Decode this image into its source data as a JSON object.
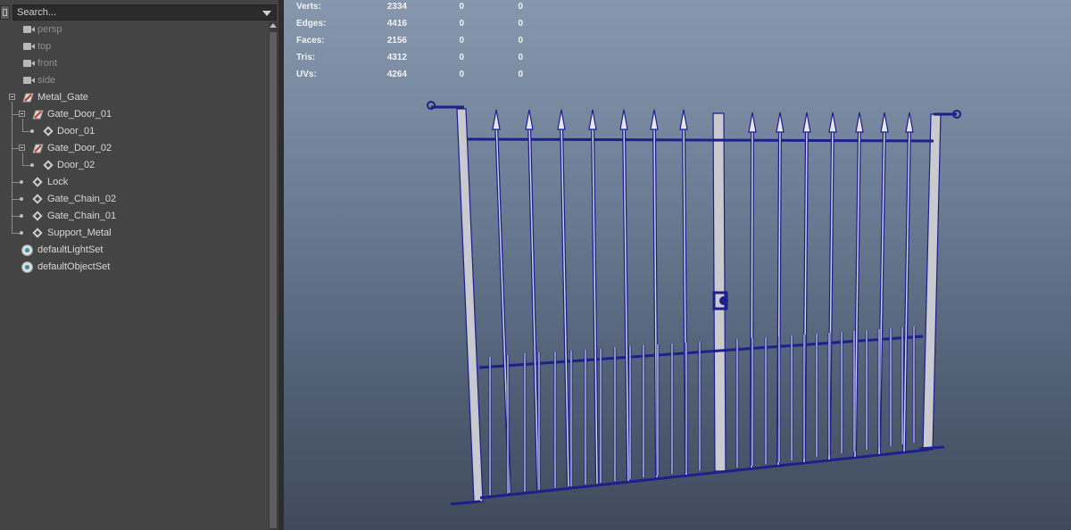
{
  "outliner": {
    "search_placeholder": "Search...",
    "cameras": [
      {
        "label": "persp",
        "icon": "camera-icon"
      },
      {
        "label": "top",
        "icon": "camera-icon"
      },
      {
        "label": "front",
        "icon": "camera-icon"
      },
      {
        "label": "side",
        "icon": "camera-icon"
      }
    ],
    "root": {
      "label": "Metal_Gate",
      "icon": "group-icon"
    },
    "items": [
      {
        "label": "Gate_Door_01",
        "icon": "group-icon"
      },
      {
        "label": "Door_01",
        "icon": "mesh-icon"
      },
      {
        "label": "Gate_Door_02",
        "icon": "group-icon"
      },
      {
        "label": "Door_02",
        "icon": "mesh-icon"
      },
      {
        "label": "Lock",
        "icon": "mesh-icon"
      },
      {
        "label": "Gate_Chain_02",
        "icon": "mesh-icon"
      },
      {
        "label": "Gate_Chain_01",
        "icon": "mesh-icon"
      },
      {
        "label": "Support_Metal",
        "icon": "mesh-icon"
      }
    ],
    "sets": [
      {
        "label": "defaultLightSet",
        "icon": "set-icon"
      },
      {
        "label": "defaultObjectSet",
        "icon": "set-icon"
      }
    ]
  },
  "hud": {
    "rows": [
      {
        "label": "Verts:",
        "v1": "2334",
        "v2": "0",
        "v3": "0"
      },
      {
        "label": "Edges:",
        "v1": "4416",
        "v2": "0",
        "v3": "0"
      },
      {
        "label": "Faces:",
        "v1": "2156",
        "v2": "0",
        "v3": "0"
      },
      {
        "label": "Tris:",
        "v1": "4312",
        "v2": "0",
        "v3": "0"
      },
      {
        "label": "UVs:",
        "v1": "4264",
        "v2": "0",
        "v3": "0"
      }
    ]
  },
  "colors": {
    "wireframe": "#1c1f8c",
    "post_fill": "#c9c9d0",
    "selection_outline": "#ffffff"
  }
}
